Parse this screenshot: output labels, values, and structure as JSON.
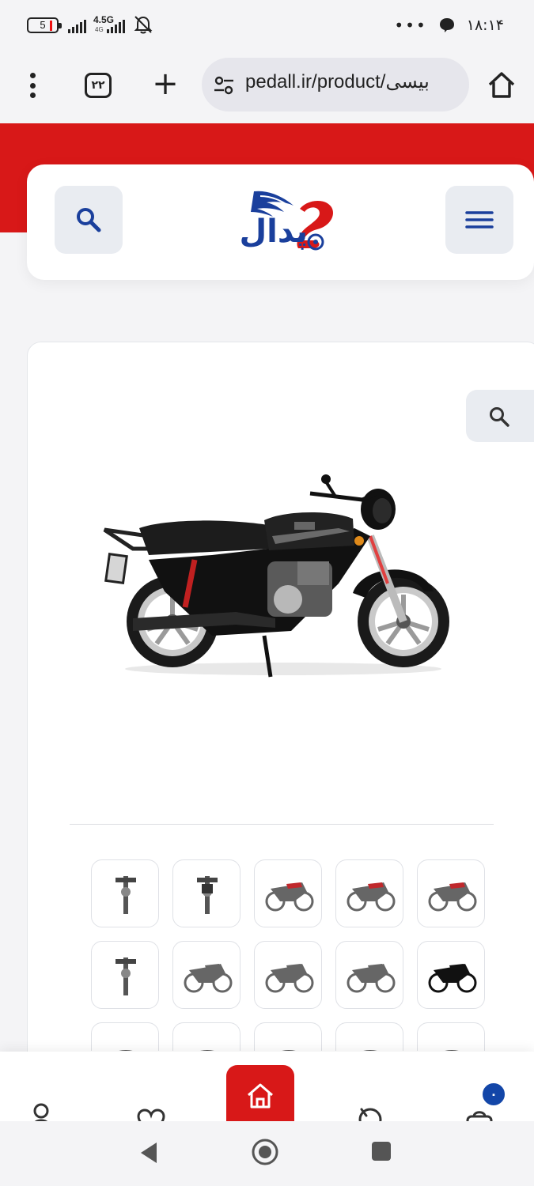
{
  "status_bar": {
    "battery_level": "5",
    "network_type": "4.5G",
    "network_sub": "4G",
    "more_dots": "•••",
    "time": "۱۸:۱۴"
  },
  "browser": {
    "tab_count": "۲۲",
    "url": "pedall.ir/product/بیسی",
    "new_tab_symbol": "+"
  },
  "site": {
    "logo_text": "پدال",
    "brand_colors": {
      "red": "#d81818",
      "blue": "#1a3f9c"
    }
  },
  "product": {
    "main_image_icon": "motorcycle-image",
    "thumbnail_rows": 3,
    "thumbnail_cols": 5
  },
  "bottom_nav": {
    "items": [
      {
        "icon": "user-icon"
      },
      {
        "icon": "heart-icon"
      },
      {
        "icon": "home-icon",
        "active": true
      },
      {
        "icon": "compare-icon"
      },
      {
        "icon": "cart-icon"
      }
    ],
    "cart_count": "۰"
  },
  "android_nav": {
    "buttons": [
      "back-icon",
      "home-circle-icon",
      "recents-icon"
    ]
  }
}
